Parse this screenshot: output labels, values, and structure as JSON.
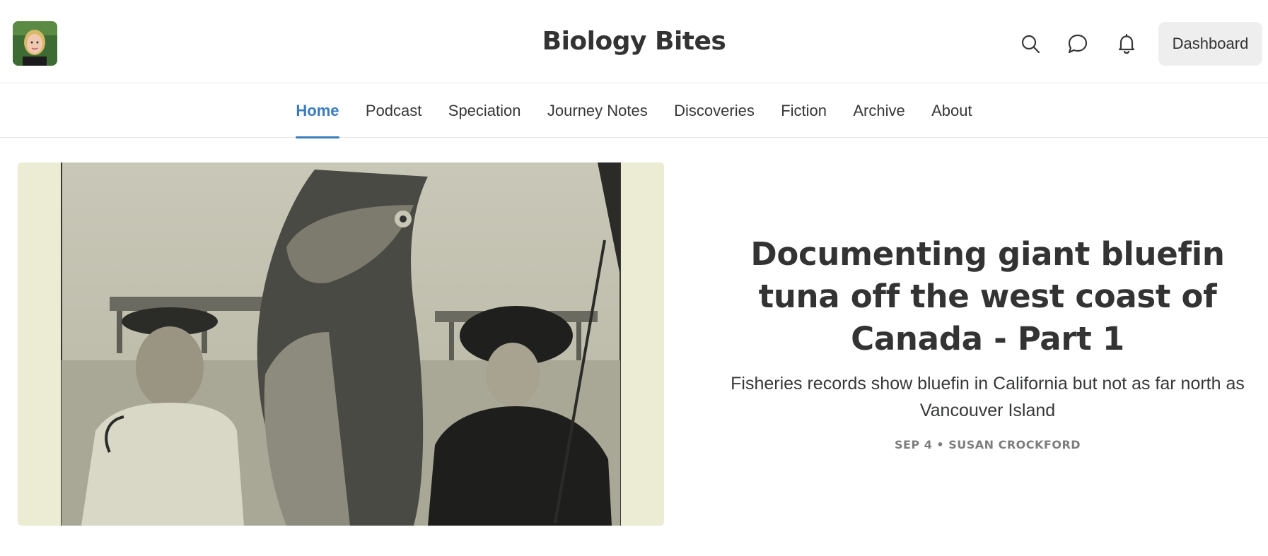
{
  "header": {
    "site_title": "Biology Bites",
    "dashboard_label": "Dashboard",
    "icons": [
      "search-icon",
      "chat-icon",
      "bell-icon"
    ]
  },
  "nav": {
    "items": [
      {
        "label": "Home",
        "active": true
      },
      {
        "label": "Podcast",
        "active": false
      },
      {
        "label": "Speciation",
        "active": false
      },
      {
        "label": "Journey Notes",
        "active": false
      },
      {
        "label": "Discoveries",
        "active": false
      },
      {
        "label": "Fiction",
        "active": false
      },
      {
        "label": "Archive",
        "active": false
      },
      {
        "label": "About",
        "active": false
      }
    ]
  },
  "featured": {
    "title": "Documenting giant bluefin tuna off the west coast of Canada - Part 1",
    "subtitle": "Fisheries records show bluefin in California but not as far north as Vancouver Island",
    "date": "SEP 4",
    "separator": "•",
    "author": "SUSAN CROCKFORD"
  },
  "colors": {
    "accent": "#3a7bbf",
    "text": "#363737",
    "meta": "#7d7d7d"
  }
}
